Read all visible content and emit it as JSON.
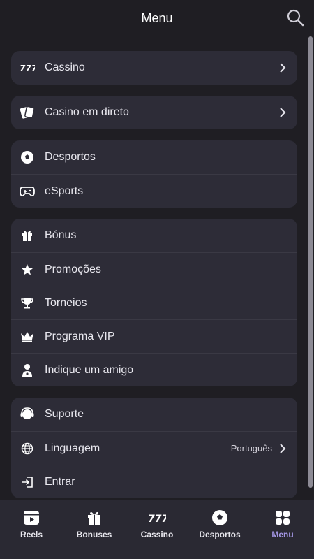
{
  "header": {
    "title": "Menu",
    "search_icon": "search-icon"
  },
  "groups": [
    {
      "items": [
        {
          "label": "Cassino",
          "icon": "slots-777-icon",
          "chevron": true
        }
      ]
    },
    {
      "items": [
        {
          "label": "Casino em direto",
          "icon": "cards-icon",
          "chevron": true
        }
      ]
    },
    {
      "items": [
        {
          "label": "Desportos",
          "icon": "soccer-ball-icon"
        },
        {
          "label": "eSports",
          "icon": "gamepad-icon"
        }
      ]
    },
    {
      "items": [
        {
          "label": "Bónus",
          "icon": "gift-icon"
        },
        {
          "label": "Promoções",
          "icon": "star-icon"
        },
        {
          "label": "Torneios",
          "icon": "trophy-icon"
        },
        {
          "label": "Programa VIP",
          "icon": "crown-icon"
        },
        {
          "label": "Indique um amigo",
          "icon": "user-icon"
        }
      ]
    },
    {
      "items": [
        {
          "label": "Suporte",
          "icon": "headset-icon"
        },
        {
          "label": "Linguagem",
          "icon": "globe-icon",
          "value": "Português",
          "chevron": true
        },
        {
          "label": "Entrar",
          "icon": "login-icon"
        }
      ]
    }
  ],
  "bottom_nav": [
    {
      "label": "Reels",
      "icon": "reels-icon",
      "active": false
    },
    {
      "label": "Bonuses",
      "icon": "gift-icon",
      "active": false
    },
    {
      "label": "Cassino",
      "icon": "slots-777-icon",
      "active": false
    },
    {
      "label": "Desportos",
      "icon": "soccer-ball-icon",
      "active": false
    },
    {
      "label": "Menu",
      "icon": "grid-icon",
      "active": true
    }
  ],
  "colors": {
    "background": "#1f1e23",
    "card": "#2d2c37",
    "nav": "#2a2933",
    "active": "#a497e6"
  }
}
